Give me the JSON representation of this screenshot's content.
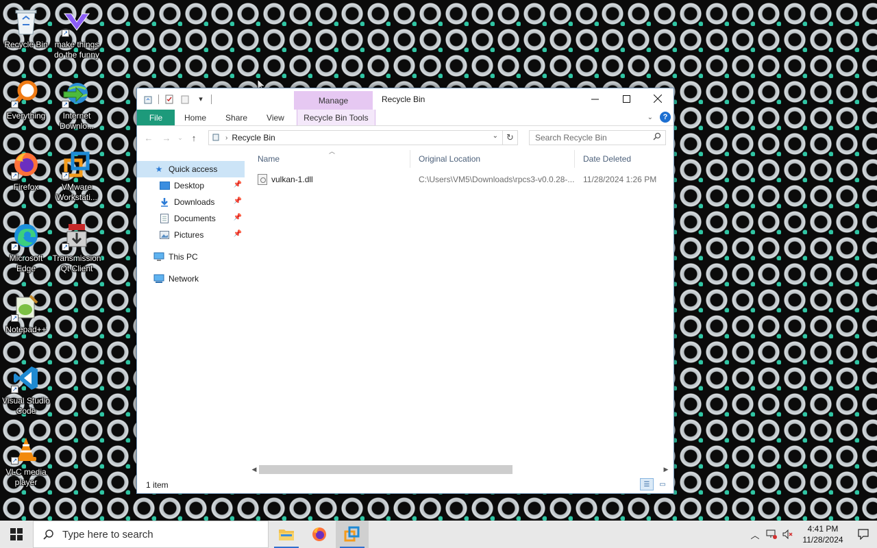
{
  "desktop": {
    "icons": [
      {
        "label": "Recycle Bin"
      },
      {
        "label": "make things do the funny"
      },
      {
        "label": "Everything"
      },
      {
        "label": "Internet Downlo..."
      },
      {
        "label": "Firefox"
      },
      {
        "label": "VMware Workstati..."
      },
      {
        "label": "Microsoft Edge"
      },
      {
        "label": "Transmission Qt Client"
      },
      {
        "label": "Notepad++"
      },
      {
        "label": "Visual Studio Code"
      },
      {
        "label": "VLC media player"
      }
    ]
  },
  "window": {
    "title": "Recycle Bin",
    "contextual_tab_group": "Manage",
    "ribbon_tabs": {
      "file": "File",
      "home": "Home",
      "share": "Share",
      "view": "View",
      "tools": "Recycle Bin Tools"
    },
    "address": {
      "location": "Recycle Bin"
    },
    "search": {
      "placeholder": "Search Recycle Bin"
    },
    "nav_pane": {
      "quick_access": "Quick access",
      "desktop": "Desktop",
      "downloads": "Downloads",
      "documents": "Documents",
      "pictures": "Pictures",
      "this_pc": "This PC",
      "network": "Network"
    },
    "columns": {
      "name": "Name",
      "original_location": "Original Location",
      "date_deleted": "Date Deleted"
    },
    "files": [
      {
        "name": "vulkan-1.dll",
        "original_location": "C:\\Users\\VM5\\Downloads\\rpcs3-v0.0.28-...",
        "date_deleted": "11/28/2024 1:26 PM"
      }
    ],
    "status": {
      "item_count": "1 item"
    }
  },
  "taskbar": {
    "search_placeholder": "Type here to search",
    "clock_time": "4:41 PM",
    "clock_date": "11/28/2024"
  },
  "colors": {
    "file_tab": "#1d9a7b",
    "manage_tab": "#e6c8f2",
    "selection": "#cce4f7",
    "accent": "#1c6fd1"
  }
}
